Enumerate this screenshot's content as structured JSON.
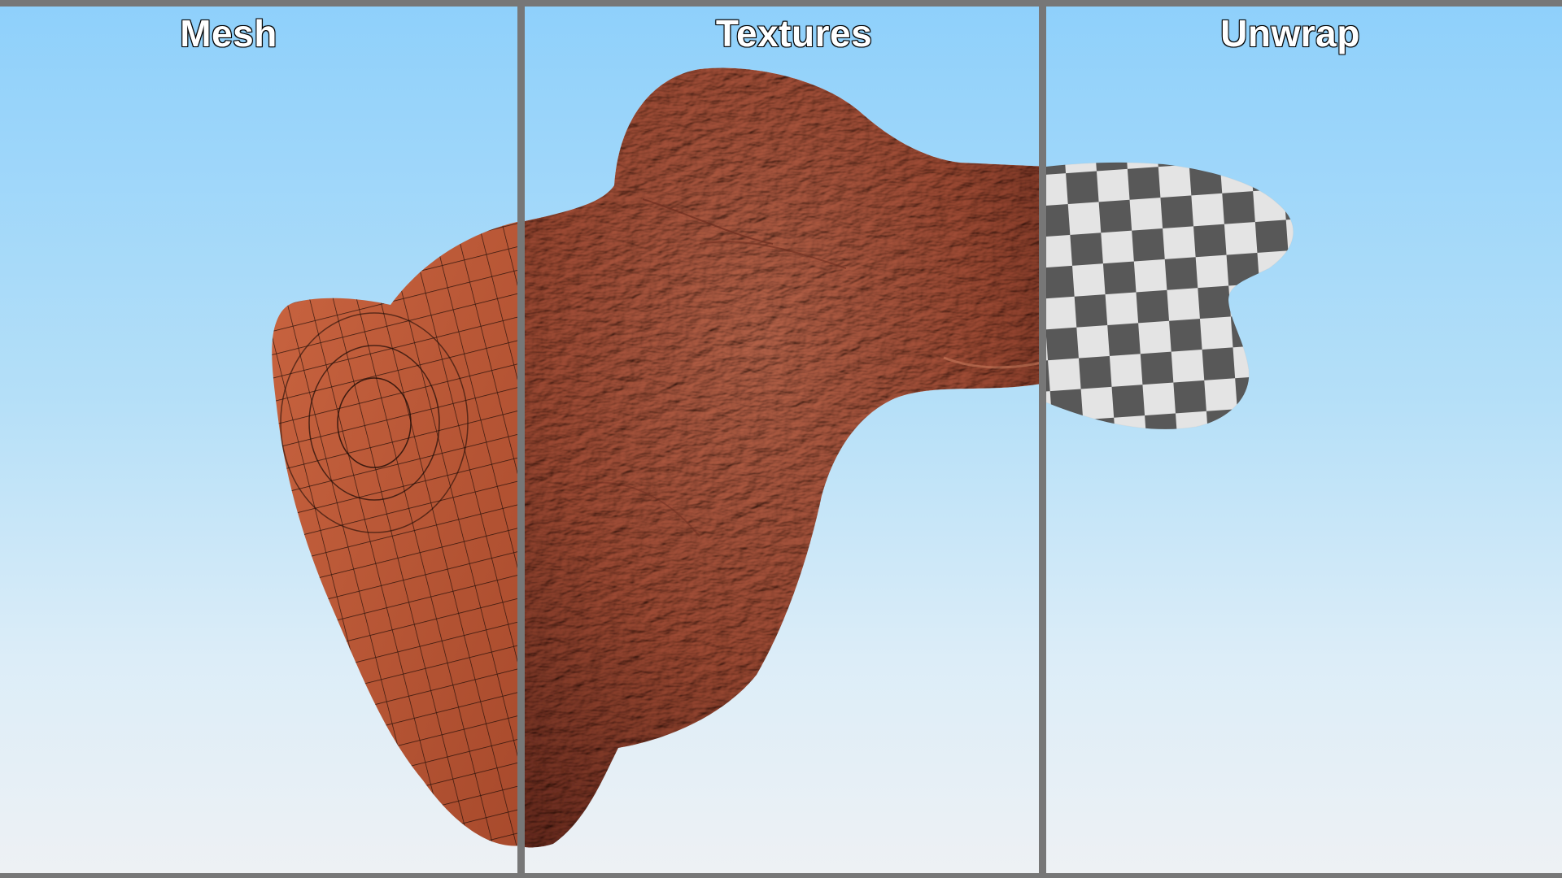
{
  "panels": [
    {
      "title": "Mesh"
    },
    {
      "title": "Textures"
    },
    {
      "title": "Unwrap"
    }
  ],
  "colors": {
    "sky_top": "#8ed0fb",
    "sky_bottom": "#eef1f4",
    "frame": "#777777",
    "clay": "#a4503a",
    "clay_dark": "#7a3424",
    "mesh_base": "#b85836",
    "wire": "#1a0a05",
    "checker_dark": "#4a4a4a",
    "checker_light": "#e2e2e2"
  }
}
